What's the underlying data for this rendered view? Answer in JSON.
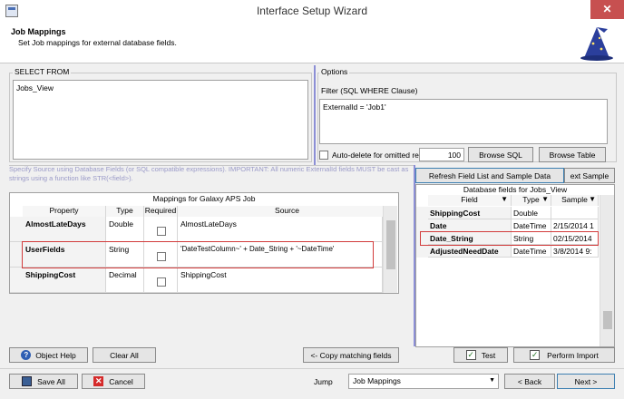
{
  "window": {
    "title": "Interface Setup Wizard",
    "close_glyph": "✕"
  },
  "header": {
    "title": "Job Mappings",
    "subtitle": "Set Job mappings for external database fields."
  },
  "select_from": {
    "label": "SELECT FROM",
    "value": "Jobs_View"
  },
  "options": {
    "label": "Options",
    "filter_label": "Filter (SQL WHERE Clause)",
    "filter_value": "ExternalId = 'Job1'",
    "autodelete_label": "Auto-delete for omitted recor",
    "autodelete_count": "100",
    "browse_sql": "Browse SQL",
    "browse_table": "Browse Table"
  },
  "hint": "Specify Source using Database Fields (or SQL compatible expressions).  IMPORTANT:  All numeric ExternalId fields MUST be cast as strings using a function like STR(<field>).",
  "mappings": {
    "title": "Mappings for Galaxy APS Job",
    "columns": [
      "Property",
      "Type",
      "Required",
      "Source"
    ],
    "rows": [
      {
        "property": "AlmostLateDays",
        "type": "Double",
        "source": "AlmostLateDays"
      },
      {
        "property": "UserFields",
        "type": "String",
        "source": "'DateTestColumn~' + Date_String + '~DateTime'"
      },
      {
        "property": "ShippingCost",
        "type": "Decimal",
        "source": "ShippingCost"
      }
    ]
  },
  "db_fields": {
    "refresh_button": "Refresh Field List and Sample Data",
    "next_sample_button": "ext Sample",
    "title": "Database fields for Jobs_View",
    "columns": [
      "Field",
      "Type",
      "Sample"
    ],
    "rows": [
      {
        "field": "ShippingCost",
        "type": "Double",
        "sample": ""
      },
      {
        "field": "Date",
        "type": "DateTime",
        "sample": "2/15/2014 1"
      },
      {
        "field": "Date_String",
        "type": "String",
        "sample": "02/15/2014"
      },
      {
        "field": "AdjustedNeedDate",
        "type": "DateTime",
        "sample": "3/8/2014 9:"
      }
    ]
  },
  "actions": {
    "object_help": "Object Help",
    "clear_all": "Clear All",
    "copy_matching": "<- Copy matching fields",
    "test": "Test",
    "perform_import": "Perform Import"
  },
  "footer": {
    "save_all": "Save All",
    "cancel": "Cancel",
    "jump_label": "Jump",
    "jump_value": "Job Mappings",
    "back": "< Back",
    "next": "Next >"
  },
  "icons": {
    "help": "?",
    "cancel": "✕",
    "check": "✓",
    "dropdown": "▼",
    "filter": "▼"
  }
}
